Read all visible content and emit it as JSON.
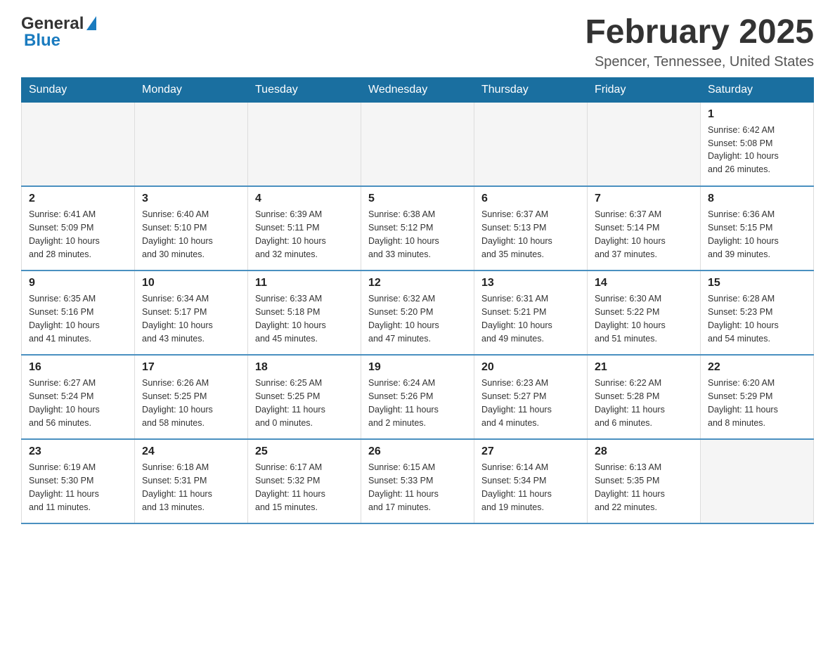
{
  "header": {
    "logo_general": "General",
    "logo_blue": "Blue",
    "month_title": "February 2025",
    "location": "Spencer, Tennessee, United States"
  },
  "weekdays": [
    "Sunday",
    "Monday",
    "Tuesday",
    "Wednesday",
    "Thursday",
    "Friday",
    "Saturday"
  ],
  "weeks": [
    [
      {
        "day": "",
        "info": ""
      },
      {
        "day": "",
        "info": ""
      },
      {
        "day": "",
        "info": ""
      },
      {
        "day": "",
        "info": ""
      },
      {
        "day": "",
        "info": ""
      },
      {
        "day": "",
        "info": ""
      },
      {
        "day": "1",
        "info": "Sunrise: 6:42 AM\nSunset: 5:08 PM\nDaylight: 10 hours\nand 26 minutes."
      }
    ],
    [
      {
        "day": "2",
        "info": "Sunrise: 6:41 AM\nSunset: 5:09 PM\nDaylight: 10 hours\nand 28 minutes."
      },
      {
        "day": "3",
        "info": "Sunrise: 6:40 AM\nSunset: 5:10 PM\nDaylight: 10 hours\nand 30 minutes."
      },
      {
        "day": "4",
        "info": "Sunrise: 6:39 AM\nSunset: 5:11 PM\nDaylight: 10 hours\nand 32 minutes."
      },
      {
        "day": "5",
        "info": "Sunrise: 6:38 AM\nSunset: 5:12 PM\nDaylight: 10 hours\nand 33 minutes."
      },
      {
        "day": "6",
        "info": "Sunrise: 6:37 AM\nSunset: 5:13 PM\nDaylight: 10 hours\nand 35 minutes."
      },
      {
        "day": "7",
        "info": "Sunrise: 6:37 AM\nSunset: 5:14 PM\nDaylight: 10 hours\nand 37 minutes."
      },
      {
        "day": "8",
        "info": "Sunrise: 6:36 AM\nSunset: 5:15 PM\nDaylight: 10 hours\nand 39 minutes."
      }
    ],
    [
      {
        "day": "9",
        "info": "Sunrise: 6:35 AM\nSunset: 5:16 PM\nDaylight: 10 hours\nand 41 minutes."
      },
      {
        "day": "10",
        "info": "Sunrise: 6:34 AM\nSunset: 5:17 PM\nDaylight: 10 hours\nand 43 minutes."
      },
      {
        "day": "11",
        "info": "Sunrise: 6:33 AM\nSunset: 5:18 PM\nDaylight: 10 hours\nand 45 minutes."
      },
      {
        "day": "12",
        "info": "Sunrise: 6:32 AM\nSunset: 5:20 PM\nDaylight: 10 hours\nand 47 minutes."
      },
      {
        "day": "13",
        "info": "Sunrise: 6:31 AM\nSunset: 5:21 PM\nDaylight: 10 hours\nand 49 minutes."
      },
      {
        "day": "14",
        "info": "Sunrise: 6:30 AM\nSunset: 5:22 PM\nDaylight: 10 hours\nand 51 minutes."
      },
      {
        "day": "15",
        "info": "Sunrise: 6:28 AM\nSunset: 5:23 PM\nDaylight: 10 hours\nand 54 minutes."
      }
    ],
    [
      {
        "day": "16",
        "info": "Sunrise: 6:27 AM\nSunset: 5:24 PM\nDaylight: 10 hours\nand 56 minutes."
      },
      {
        "day": "17",
        "info": "Sunrise: 6:26 AM\nSunset: 5:25 PM\nDaylight: 10 hours\nand 58 minutes."
      },
      {
        "day": "18",
        "info": "Sunrise: 6:25 AM\nSunset: 5:25 PM\nDaylight: 11 hours\nand 0 minutes."
      },
      {
        "day": "19",
        "info": "Sunrise: 6:24 AM\nSunset: 5:26 PM\nDaylight: 11 hours\nand 2 minutes."
      },
      {
        "day": "20",
        "info": "Sunrise: 6:23 AM\nSunset: 5:27 PM\nDaylight: 11 hours\nand 4 minutes."
      },
      {
        "day": "21",
        "info": "Sunrise: 6:22 AM\nSunset: 5:28 PM\nDaylight: 11 hours\nand 6 minutes."
      },
      {
        "day": "22",
        "info": "Sunrise: 6:20 AM\nSunset: 5:29 PM\nDaylight: 11 hours\nand 8 minutes."
      }
    ],
    [
      {
        "day": "23",
        "info": "Sunrise: 6:19 AM\nSunset: 5:30 PM\nDaylight: 11 hours\nand 11 minutes."
      },
      {
        "day": "24",
        "info": "Sunrise: 6:18 AM\nSunset: 5:31 PM\nDaylight: 11 hours\nand 13 minutes."
      },
      {
        "day": "25",
        "info": "Sunrise: 6:17 AM\nSunset: 5:32 PM\nDaylight: 11 hours\nand 15 minutes."
      },
      {
        "day": "26",
        "info": "Sunrise: 6:15 AM\nSunset: 5:33 PM\nDaylight: 11 hours\nand 17 minutes."
      },
      {
        "day": "27",
        "info": "Sunrise: 6:14 AM\nSunset: 5:34 PM\nDaylight: 11 hours\nand 19 minutes."
      },
      {
        "day": "28",
        "info": "Sunrise: 6:13 AM\nSunset: 5:35 PM\nDaylight: 11 hours\nand 22 minutes."
      },
      {
        "day": "",
        "info": ""
      }
    ]
  ]
}
